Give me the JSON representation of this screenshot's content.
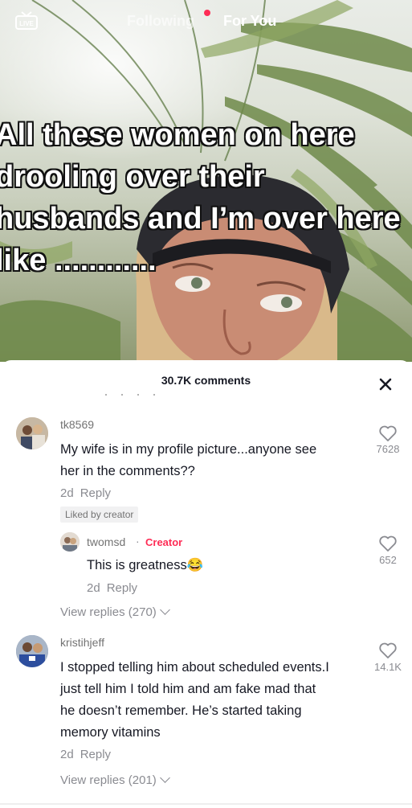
{
  "nav": {
    "following": "Following",
    "for_you": "For You",
    "live_icon": "live-tv-icon"
  },
  "video": {
    "caption_lines": [
      "All these women on here",
      "drooling over their",
      "husbands and I’m over here",
      "like ............"
    ]
  },
  "sheet": {
    "comment_count": "30.7K comments",
    "close_icon": "close-icon"
  },
  "comments": [
    {
      "username": "tk8569",
      "text_lines": [
        "My wife is in my profile picture...anyone see",
        "her in the comments??"
      ],
      "time": "2d",
      "reply": "Reply",
      "liked_by_creator": "Liked by creator",
      "likes": "7628",
      "view_replies": "View replies (270)"
    },
    {
      "username": "twomsd",
      "creator_label": "Creator",
      "text": "This is greatness",
      "emoji": "😂",
      "time": "2d",
      "reply": "Reply",
      "likes": "652"
    },
    {
      "username": "kristihjeff",
      "text_lines": [
        "I stopped telling him about scheduled events.I",
        "just tell him I told him and am fake mad that",
        "he doesn’t remember. He’s started taking",
        "memory vitamins"
      ],
      "time": "2d",
      "reply": "Reply",
      "likes": "14.1K",
      "view_replies": "View replies (201)"
    }
  ],
  "colors": {
    "accent": "#fe2c55",
    "text_primary": "#161823",
    "text_secondary": "#8a8b91"
  }
}
